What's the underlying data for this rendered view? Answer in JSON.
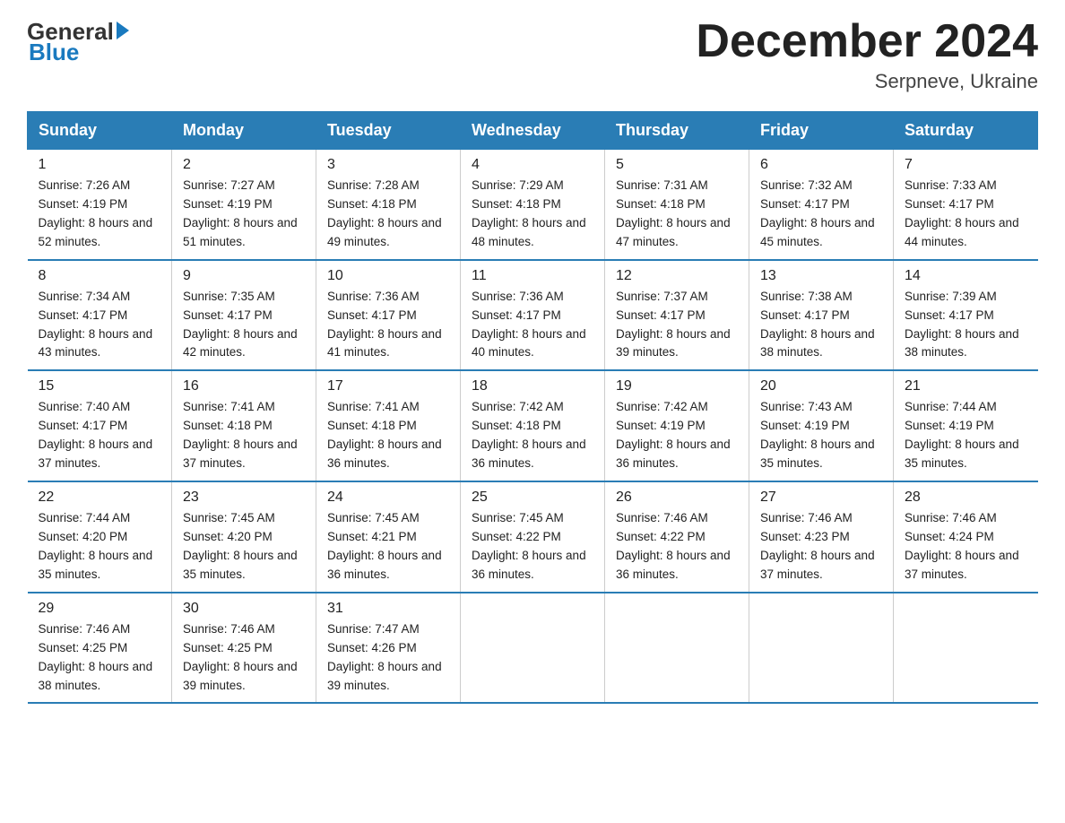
{
  "header": {
    "logo_general": "General",
    "logo_blue": "Blue",
    "month_title": "December 2024",
    "location": "Serpneve, Ukraine"
  },
  "days_of_week": [
    "Sunday",
    "Monday",
    "Tuesday",
    "Wednesday",
    "Thursday",
    "Friday",
    "Saturday"
  ],
  "weeks": [
    [
      {
        "day": "1",
        "sunrise": "7:26 AM",
        "sunset": "4:19 PM",
        "daylight": "8 hours and 52 minutes."
      },
      {
        "day": "2",
        "sunrise": "7:27 AM",
        "sunset": "4:19 PM",
        "daylight": "8 hours and 51 minutes."
      },
      {
        "day": "3",
        "sunrise": "7:28 AM",
        "sunset": "4:18 PM",
        "daylight": "8 hours and 49 minutes."
      },
      {
        "day": "4",
        "sunrise": "7:29 AM",
        "sunset": "4:18 PM",
        "daylight": "8 hours and 48 minutes."
      },
      {
        "day": "5",
        "sunrise": "7:31 AM",
        "sunset": "4:18 PM",
        "daylight": "8 hours and 47 minutes."
      },
      {
        "day": "6",
        "sunrise": "7:32 AM",
        "sunset": "4:17 PM",
        "daylight": "8 hours and 45 minutes."
      },
      {
        "day": "7",
        "sunrise": "7:33 AM",
        "sunset": "4:17 PM",
        "daylight": "8 hours and 44 minutes."
      }
    ],
    [
      {
        "day": "8",
        "sunrise": "7:34 AM",
        "sunset": "4:17 PM",
        "daylight": "8 hours and 43 minutes."
      },
      {
        "day": "9",
        "sunrise": "7:35 AM",
        "sunset": "4:17 PM",
        "daylight": "8 hours and 42 minutes."
      },
      {
        "day": "10",
        "sunrise": "7:36 AM",
        "sunset": "4:17 PM",
        "daylight": "8 hours and 41 minutes."
      },
      {
        "day": "11",
        "sunrise": "7:36 AM",
        "sunset": "4:17 PM",
        "daylight": "8 hours and 40 minutes."
      },
      {
        "day": "12",
        "sunrise": "7:37 AM",
        "sunset": "4:17 PM",
        "daylight": "8 hours and 39 minutes."
      },
      {
        "day": "13",
        "sunrise": "7:38 AM",
        "sunset": "4:17 PM",
        "daylight": "8 hours and 38 minutes."
      },
      {
        "day": "14",
        "sunrise": "7:39 AM",
        "sunset": "4:17 PM",
        "daylight": "8 hours and 38 minutes."
      }
    ],
    [
      {
        "day": "15",
        "sunrise": "7:40 AM",
        "sunset": "4:17 PM",
        "daylight": "8 hours and 37 minutes."
      },
      {
        "day": "16",
        "sunrise": "7:41 AM",
        "sunset": "4:18 PM",
        "daylight": "8 hours and 37 minutes."
      },
      {
        "day": "17",
        "sunrise": "7:41 AM",
        "sunset": "4:18 PM",
        "daylight": "8 hours and 36 minutes."
      },
      {
        "day": "18",
        "sunrise": "7:42 AM",
        "sunset": "4:18 PM",
        "daylight": "8 hours and 36 minutes."
      },
      {
        "day": "19",
        "sunrise": "7:42 AM",
        "sunset": "4:19 PM",
        "daylight": "8 hours and 36 minutes."
      },
      {
        "day": "20",
        "sunrise": "7:43 AM",
        "sunset": "4:19 PM",
        "daylight": "8 hours and 35 minutes."
      },
      {
        "day": "21",
        "sunrise": "7:44 AM",
        "sunset": "4:19 PM",
        "daylight": "8 hours and 35 minutes."
      }
    ],
    [
      {
        "day": "22",
        "sunrise": "7:44 AM",
        "sunset": "4:20 PM",
        "daylight": "8 hours and 35 minutes."
      },
      {
        "day": "23",
        "sunrise": "7:45 AM",
        "sunset": "4:20 PM",
        "daylight": "8 hours and 35 minutes."
      },
      {
        "day": "24",
        "sunrise": "7:45 AM",
        "sunset": "4:21 PM",
        "daylight": "8 hours and 36 minutes."
      },
      {
        "day": "25",
        "sunrise": "7:45 AM",
        "sunset": "4:22 PM",
        "daylight": "8 hours and 36 minutes."
      },
      {
        "day": "26",
        "sunrise": "7:46 AM",
        "sunset": "4:22 PM",
        "daylight": "8 hours and 36 minutes."
      },
      {
        "day": "27",
        "sunrise": "7:46 AM",
        "sunset": "4:23 PM",
        "daylight": "8 hours and 37 minutes."
      },
      {
        "day": "28",
        "sunrise": "7:46 AM",
        "sunset": "4:24 PM",
        "daylight": "8 hours and 37 minutes."
      }
    ],
    [
      {
        "day": "29",
        "sunrise": "7:46 AM",
        "sunset": "4:25 PM",
        "daylight": "8 hours and 38 minutes."
      },
      {
        "day": "30",
        "sunrise": "7:46 AM",
        "sunset": "4:25 PM",
        "daylight": "8 hours and 39 minutes."
      },
      {
        "day": "31",
        "sunrise": "7:47 AM",
        "sunset": "4:26 PM",
        "daylight": "8 hours and 39 minutes."
      },
      {
        "day": "",
        "sunrise": "",
        "sunset": "",
        "daylight": ""
      },
      {
        "day": "",
        "sunrise": "",
        "sunset": "",
        "daylight": ""
      },
      {
        "day": "",
        "sunrise": "",
        "sunset": "",
        "daylight": ""
      },
      {
        "day": "",
        "sunrise": "",
        "sunset": "",
        "daylight": ""
      }
    ]
  ],
  "labels": {
    "sunrise": "Sunrise: ",
    "sunset": "Sunset: ",
    "daylight": "Daylight: "
  }
}
